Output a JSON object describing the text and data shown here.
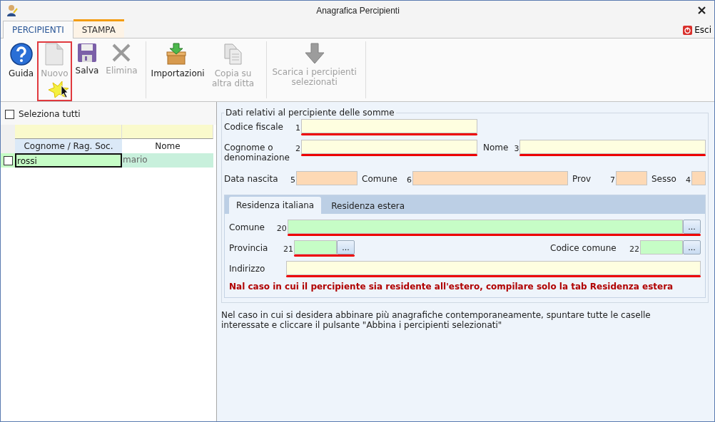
{
  "window": {
    "title": "Anagrafica Percipienti"
  },
  "ribbon_tabs": [
    {
      "label": "PERCIPIENTI",
      "selected": true
    },
    {
      "label": "STAMPA",
      "selected": false
    }
  ],
  "exit_button": {
    "label": "Esci"
  },
  "toolbar": [
    [
      {
        "kind": "help",
        "label": "Guida",
        "disabled": false,
        "highlighted": false
      },
      {
        "kind": "new",
        "label": "Nuovo",
        "disabled": true,
        "highlighted": true
      },
      {
        "kind": "save",
        "label": "Salva",
        "disabled": false,
        "highlighted": false
      },
      {
        "kind": "delete",
        "label": "Elimina",
        "disabled": true,
        "highlighted": false
      }
    ],
    [
      {
        "kind": "import",
        "label": "Importazioni",
        "disabled": false,
        "highlighted": false
      },
      {
        "kind": "copy",
        "label": "Copia su altra ditta",
        "disabled": true,
        "highlighted": false
      }
    ],
    [
      {
        "kind": "download",
        "label": "Scarica i percipienti selezionati",
        "disabled": true,
        "highlighted": false
      }
    ]
  ],
  "select_all": {
    "label": "Seleziona tutti",
    "checked": false
  },
  "grid": {
    "columns": [
      {
        "label": "Cognome / Rag. Soc.",
        "selected": true
      },
      {
        "label": "Nome",
        "selected": false
      }
    ],
    "rows": [
      {
        "checked": false,
        "selected": true,
        "cells": [
          "rossi",
          "mario"
        ]
      }
    ]
  },
  "details": {
    "legend": "Dati relativi al percipiente delle somme",
    "rows": [
      [
        {
          "label": "Codice fiscale",
          "number": "1",
          "color": "#fefee0",
          "required": true
        }
      ],
      [
        {
          "label": "Cognome o denominazione",
          "number": "2",
          "color": "#fefee0",
          "required": true
        },
        {
          "label": "Nome",
          "number": "3",
          "color": "#fefee0",
          "required": true
        }
      ],
      [
        {
          "label": "Data nascita",
          "number": "5",
          "color": "#fdd9b5",
          "required": false
        },
        {
          "label": "Comune",
          "number": "6",
          "color": "#fdd9b5",
          "required": false
        },
        {
          "label": "Prov",
          "number": "7",
          "color": "#fdd9b5",
          "required": false
        },
        {
          "label": "Sesso",
          "number": "4",
          "color": "#fdd9b5",
          "required": false
        }
      ]
    ]
  },
  "residence": {
    "tabs": [
      {
        "label": "Residenza italiana",
        "selected": true
      },
      {
        "label": "Residenza estera",
        "selected": false
      }
    ],
    "rows": [
      [
        {
          "label": "Comune",
          "number": "20",
          "color": "#c6fdc6",
          "required": true,
          "picker": "..."
        }
      ],
      [
        {
          "label": "Provincia",
          "number": "21",
          "color": "#c6fdc6",
          "required": true,
          "picker": "..."
        },
        {
          "label": "Codice comune",
          "number": "22",
          "color": "#c6fdc6",
          "required": false,
          "picker": "..."
        }
      ],
      [
        {
          "label": "Indirizzo",
          "color": "#fefee0",
          "required": true
        }
      ]
    ],
    "warning": "Nal caso in cui il percipiente sia residente all'estero, compilare solo la tab Residenza estera"
  },
  "note": "Nel caso in cui si desidera abbinare più anagrafiche contemporaneamente, spuntare tutte le caselle interessate e cliccare il pulsante \"Abbina i percipienti selezionati\""
}
